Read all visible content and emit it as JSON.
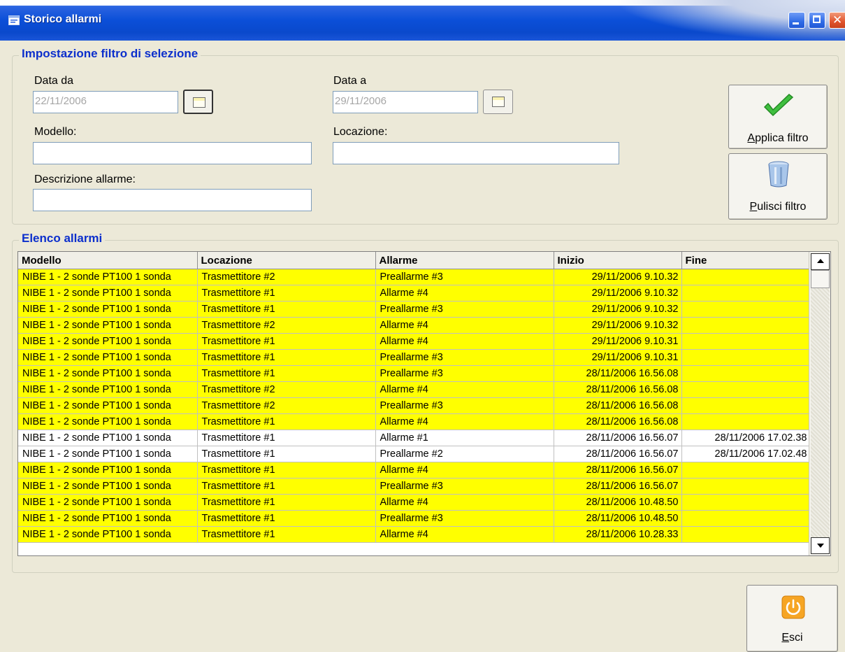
{
  "window": {
    "title": "Storico allarmi",
    "icon": "app-window-icon"
  },
  "filter": {
    "legend": "Impostazione filtro di selezione",
    "date_from_label": "Data da",
    "date_from_value": "22/11/2006",
    "date_to_label": "Data a",
    "date_to_value": "29/11/2006",
    "model_label": "Modello:",
    "model_value": "",
    "location_label": "Locazione:",
    "location_value": "",
    "description_label": "Descrizione allarme:",
    "description_value": "",
    "apply_button": {
      "mnemonic": "A",
      "rest": "pplica filtro",
      "icon": "checkmark-icon"
    },
    "clear_button": {
      "mnemonic": "P",
      "rest": "ulisci filtro",
      "icon": "trash-bin-icon"
    }
  },
  "list": {
    "legend": "Elenco allarmi",
    "columns": [
      "Modello",
      "Locazione",
      "Allarme",
      "Inizio",
      "Fine"
    ],
    "rows": [
      {
        "modello": "NIBE 1 - 2 sonde PT100 1 sonda",
        "locazione": "Trasmettitore #2",
        "allarme": "Preallarme #3",
        "inizio": "29/11/2006 9.10.32",
        "fine": "",
        "active": true
      },
      {
        "modello": "NIBE 1 - 2 sonde PT100 1 sonda",
        "locazione": "Trasmettitore #1",
        "allarme": "Allarme #4",
        "inizio": "29/11/2006 9.10.32",
        "fine": "",
        "active": true
      },
      {
        "modello": "NIBE 1 - 2 sonde PT100 1 sonda",
        "locazione": "Trasmettitore #1",
        "allarme": "Preallarme #3",
        "inizio": "29/11/2006 9.10.32",
        "fine": "",
        "active": true
      },
      {
        "modello": "NIBE 1 - 2 sonde PT100 1 sonda",
        "locazione": "Trasmettitore #2",
        "allarme": "Allarme #4",
        "inizio": "29/11/2006 9.10.32",
        "fine": "",
        "active": true
      },
      {
        "modello": "NIBE 1 - 2 sonde PT100 1 sonda",
        "locazione": "Trasmettitore #1",
        "allarme": "Allarme #4",
        "inizio": "29/11/2006 9.10.31",
        "fine": "",
        "active": true
      },
      {
        "modello": "NIBE 1 - 2 sonde PT100 1 sonda",
        "locazione": "Trasmettitore #1",
        "allarme": "Preallarme #3",
        "inizio": "29/11/2006 9.10.31",
        "fine": "",
        "active": true
      },
      {
        "modello": "NIBE 1 - 2 sonde PT100 1 sonda",
        "locazione": "Trasmettitore #1",
        "allarme": "Preallarme #3",
        "inizio": "28/11/2006 16.56.08",
        "fine": "",
        "active": true
      },
      {
        "modello": "NIBE 1 - 2 sonde PT100 1 sonda",
        "locazione": "Trasmettitore #2",
        "allarme": "Allarme #4",
        "inizio": "28/11/2006 16.56.08",
        "fine": "",
        "active": true
      },
      {
        "modello": "NIBE 1 - 2 sonde PT100 1 sonda",
        "locazione": "Trasmettitore #2",
        "allarme": "Preallarme #3",
        "inizio": "28/11/2006 16.56.08",
        "fine": "",
        "active": true
      },
      {
        "modello": "NIBE 1 - 2 sonde PT100 1 sonda",
        "locazione": "Trasmettitore #1",
        "allarme": "Allarme #4",
        "inizio": "28/11/2006 16.56.08",
        "fine": "",
        "active": true
      },
      {
        "modello": "NIBE 1 - 2 sonde PT100 1 sonda",
        "locazione": "Trasmettitore #1",
        "allarme": "Allarme #1",
        "inizio": "28/11/2006 16.56.07",
        "fine": "28/11/2006 17.02.38",
        "active": false
      },
      {
        "modello": "NIBE 1 - 2 sonde PT100 1 sonda",
        "locazione": "Trasmettitore #1",
        "allarme": "Preallarme #2",
        "inizio": "28/11/2006 16.56.07",
        "fine": "28/11/2006 17.02.48",
        "active": false
      },
      {
        "modello": "NIBE 1 - 2 sonde PT100 1 sonda",
        "locazione": "Trasmettitore #1",
        "allarme": "Allarme #4",
        "inizio": "28/11/2006 16.56.07",
        "fine": "",
        "active": true
      },
      {
        "modello": "NIBE 1 - 2 sonde PT100 1 sonda",
        "locazione": "Trasmettitore #1",
        "allarme": "Preallarme #3",
        "inizio": "28/11/2006 16.56.07",
        "fine": "",
        "active": true
      },
      {
        "modello": "NIBE 1 - 2 sonde PT100 1 sonda",
        "locazione": "Trasmettitore #1",
        "allarme": "Allarme #4",
        "inizio": "28/11/2006 10.48.50",
        "fine": "",
        "active": true
      },
      {
        "modello": "NIBE 1 - 2 sonde PT100 1 sonda",
        "locazione": "Trasmettitore #1",
        "allarme": "Preallarme #3",
        "inizio": "28/11/2006 10.48.50",
        "fine": "",
        "active": true
      },
      {
        "modello": "NIBE 1 - 2 sonde PT100 1 sonda",
        "locazione": "Trasmettitore #1",
        "allarme": "Allarme #4",
        "inizio": "28/11/2006 10.28.33",
        "fine": "",
        "active": true
      }
    ]
  },
  "exit_button": {
    "mnemonic": "E",
    "rest": "sci",
    "icon": "power-icon"
  },
  "colors": {
    "active_row": "#ffff00",
    "legend_text": "#0c2fcc",
    "titlebar": "#0b4fd8"
  }
}
